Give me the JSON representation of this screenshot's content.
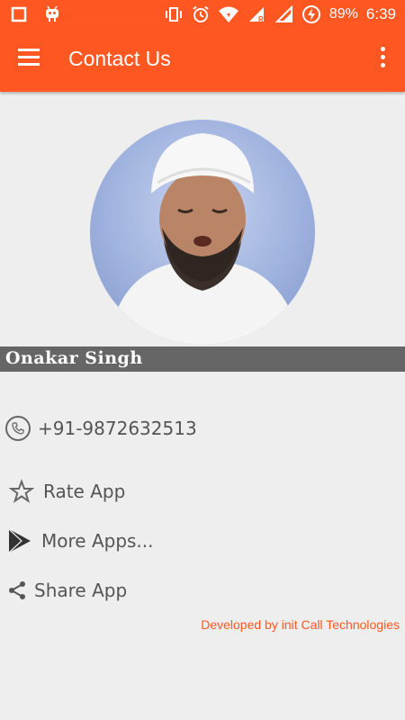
{
  "status_bar": {
    "battery": "89%",
    "time": "6:39"
  },
  "app_bar": {
    "title": "Contact Us"
  },
  "profile": {
    "name": "Onakar  Singh"
  },
  "contact": {
    "phone": "+91-9872632513"
  },
  "actions": {
    "rate_label": "Rate App",
    "more_label": "More Apps...",
    "share_label": "Share App"
  },
  "footer": {
    "credit": "Developed by init Call Technologies"
  },
  "colors": {
    "accent": "#ff5722",
    "name_bar": "#666666",
    "background": "#eeeeee"
  }
}
